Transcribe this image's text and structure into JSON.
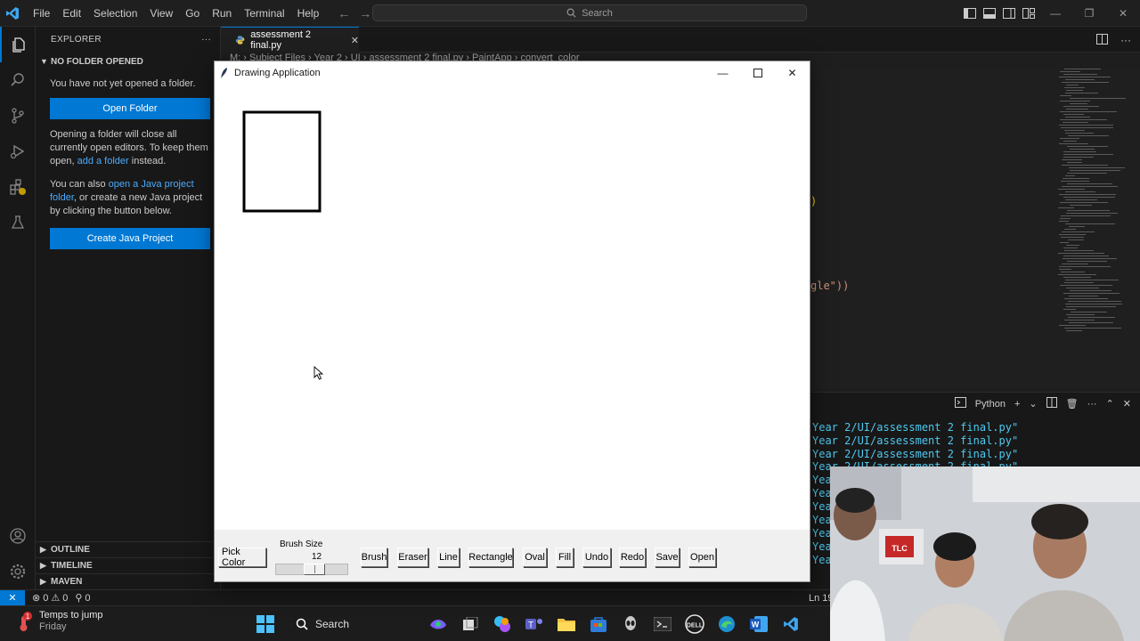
{
  "vscode": {
    "menu": [
      "File",
      "Edit",
      "Selection",
      "View",
      "Go",
      "Run",
      "Terminal",
      "Help"
    ],
    "search_placeholder": "Search",
    "explorer": {
      "header": "EXPLORER",
      "section": "NO FOLDER OPENED",
      "msg_not_opened": "You have not yet opened a folder.",
      "open_folder_button": "Open Folder",
      "msg_close_1": "Opening a folder will close all currently open editors. To keep them open, ",
      "msg_close_link": "add a folder",
      "msg_close_2": " instead.",
      "msg_java_1": "You can also ",
      "msg_java_link": "open a Java project folder",
      "msg_java_2": ", or create a new Java project by clicking the button below.",
      "create_java_button": "Create Java Project",
      "bottom_sections": [
        "OUTLINE",
        "TIMELINE",
        "MAVEN"
      ]
    },
    "tab": {
      "label": "assessment 2 final.py"
    },
    "breadcrumb": "M: › Subject Files › Year 2 › UI › assessment 2 final.py › PaintApp › convert_color",
    "code_fragments": {
      "paren": ")",
      "rect_str": "gle\"))"
    },
    "panel": {
      "shell_label": "Python",
      "terminal_lines": [
        "Year 2/UI/assessment 2 final.py\"",
        "Year 2/UI/assessment 2 final.py\"",
        "Year 2/UI/assessment 2 final.py\"",
        "Year 2/UI/assessment 2 final.py\"",
        "Yea",
        "Yea",
        "Yea",
        "Yea",
        "Yea",
        "Yea",
        "Yea"
      ]
    },
    "status": {
      "errors": "0",
      "warnings": "0",
      "ports": "0",
      "position": "Ln 195,"
    }
  },
  "taskbar": {
    "weather_title": "Temps to jump",
    "weather_sub": "Friday",
    "notification_count": "1",
    "search_label": "Search"
  },
  "drawing_app": {
    "title": "Drawing Application",
    "brush_size_label": "Brush Size",
    "brush_size_value": "12",
    "brush_slider_fraction": 0.55,
    "buttons": {
      "pick_color": "Pick Color",
      "brush": "Brush",
      "eraser": "Eraser",
      "line": "Line",
      "rectangle": "Rectangle",
      "oval": "Oval",
      "fill": "Fill",
      "undo": "Undo",
      "redo": "Redo",
      "save": "Save",
      "open": "Open"
    }
  },
  "colors": {
    "accent": "#0078d4",
    "link": "#4daafc",
    "terminal_text": "#4ec9f0"
  }
}
